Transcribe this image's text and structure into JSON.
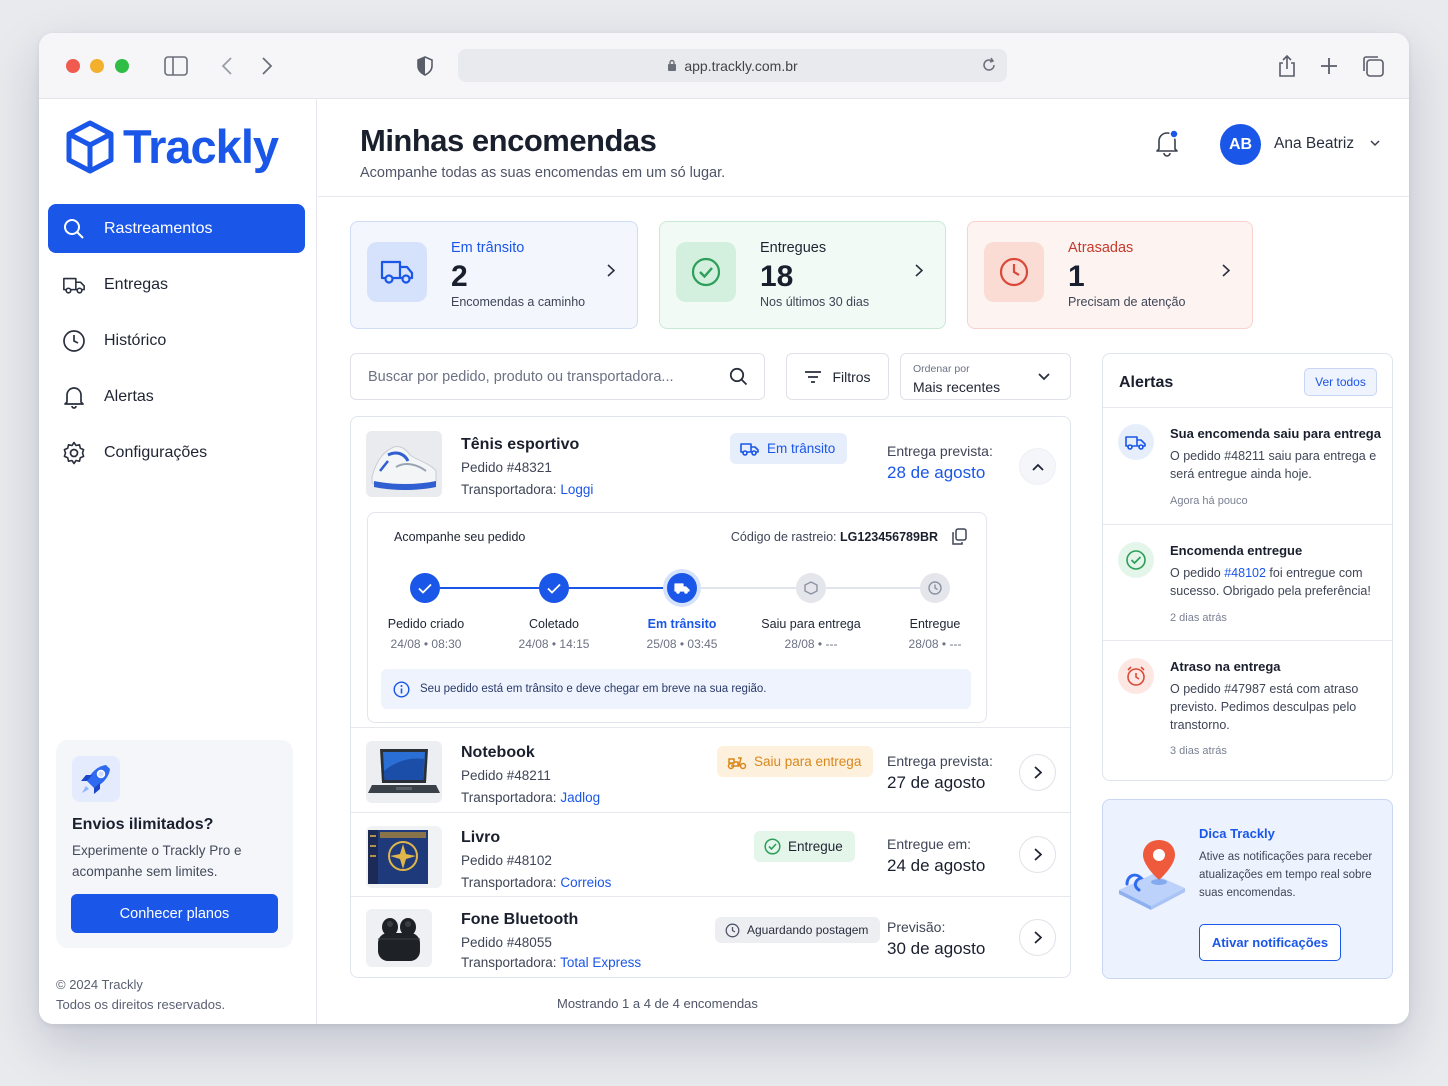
{
  "browser": {
    "url": "app.trackly.com.br"
  },
  "brand": {
    "name": "Trackly",
    "accent": "#1a56e8"
  },
  "sidebar": {
    "items": [
      {
        "label": "Rastreamentos",
        "icon": "search-icon",
        "active": true
      },
      {
        "label": "Entregas",
        "icon": "truck-icon"
      },
      {
        "label": "Histórico",
        "icon": "clock-icon"
      },
      {
        "label": "Alertas",
        "icon": "bell-icon"
      },
      {
        "label": "Configurações",
        "icon": "gear-icon"
      }
    ],
    "promo": {
      "title": "Envios ilimitados?",
      "text": "Experimente o Trackly Pro e acompanhe sem limites.",
      "button": "Conhecer planos"
    },
    "copyright": "© 2024 Trackly",
    "rights": "Todos os direitos reservados."
  },
  "header": {
    "title": "Minhas encomendas",
    "subtitle": "Acompanhe todas as suas encomendas em um só lugar.",
    "user": {
      "initials": "AB",
      "name": "Ana Beatriz"
    }
  },
  "stats": [
    {
      "label": "Em trânsito",
      "value": "2",
      "note": "Encomendas a caminho",
      "color": "#1a56e8"
    },
    {
      "label": "Entregues",
      "value": "18",
      "note": "Nos últimos 30 dias",
      "color": "#2e9e5b"
    },
    {
      "label": "Atrasadas",
      "value": "1",
      "note": "Precisam de atenção",
      "color": "#d94a3a"
    }
  ],
  "toolbar": {
    "search_placeholder": "Buscar por pedido, produto ou transportadora...",
    "filters": "Filtros",
    "sort_label": "Ordenar por",
    "sort_value": "Mais recentes"
  },
  "orders": [
    {
      "name": "Tênis esportivo",
      "id": "Pedido #48321",
      "carrier_label": "Transportadora:",
      "carrier": "Loggi",
      "status": "Em trânsito",
      "date_label": "Entrega prevista:",
      "date": "28 de agosto",
      "tracking": {
        "title": "Acompanhe seu pedido",
        "code_label": "Código de rastreio:",
        "code": "LG123456789BR",
        "steps": [
          {
            "label": "Pedido criado",
            "date": "24/08 • 08:30",
            "state": "done"
          },
          {
            "label": "Coletado",
            "date": "24/08 • 14:15",
            "state": "done"
          },
          {
            "label": "Em trânsito",
            "date": "25/08 • 03:45",
            "state": "current"
          },
          {
            "label": "Saiu para entrega",
            "date": "28/08 • ---",
            "state": "pending"
          },
          {
            "label": "Entregue",
            "date": "28/08 • ---",
            "state": "pending"
          }
        ],
        "info": "Seu pedido está em trânsito e deve chegar em breve na sua região."
      }
    },
    {
      "name": "Notebook",
      "id": "Pedido #48211",
      "carrier_label": "Transportadora:",
      "carrier": "Jadlog",
      "status": "Saiu para entrega",
      "date_label": "Entrega prevista:",
      "date": "27 de agosto"
    },
    {
      "name": "Livro",
      "id": "Pedido #48102",
      "carrier_label": "Transportadora:",
      "carrier": "Correios",
      "status": "Entregue",
      "date_label": "Entregue em:",
      "date": "24 de agosto"
    },
    {
      "name": "Fone Bluetooth",
      "id": "Pedido #48055",
      "carrier_label": "Transportadora:",
      "carrier": "Total Express",
      "status": "Aguardando postagem",
      "date_label": "Previsão:",
      "date": "30 de agosto"
    }
  ],
  "list_footer": "Mostrando 1 a 4 de 4 encomendas",
  "alerts": {
    "title": "Alertas",
    "view_all": "Ver todos",
    "items": [
      {
        "title": "Sua encomenda saiu para entrega",
        "body": "O pedido #48211 saiu para entrega e será entregue ainda hoje.",
        "time": "Agora há pouco"
      },
      {
        "title": "Encomenda entregue",
        "body_pre": "O pedido ",
        "body_link": "#48102",
        "body_post": " foi entregue com sucesso. Obrigado pela preferência!",
        "time": "2 dias atrás"
      },
      {
        "title": "Atraso na entrega",
        "body": "O pedido #47987 está com atraso previsto. Pedimos desculpas pelo transtorno.",
        "time": "3 dias atrás"
      }
    ]
  },
  "tip": {
    "title": "Dica Trackly",
    "text": "Ative as notificações para receber atualizações em tempo real sobre suas encomendas.",
    "button": "Ativar notificações"
  }
}
